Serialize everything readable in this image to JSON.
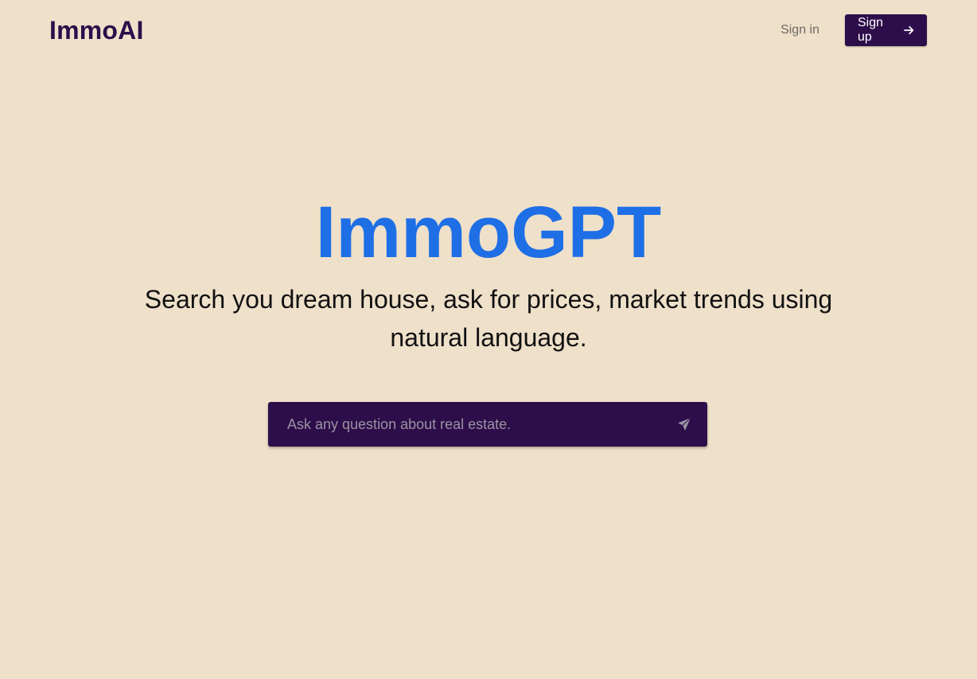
{
  "header": {
    "brand": "ImmoAI",
    "signin_label": "Sign in",
    "signup_label": "Sign up"
  },
  "hero": {
    "title": "ImmoGPT",
    "subtitle": "Search you dream house, ask for prices, market trends using natural language."
  },
  "search": {
    "placeholder": "Ask any question about real estate.",
    "value": "",
    "send_icon": "send-icon"
  },
  "colors": {
    "background": "#EFE0CA",
    "brand": "#2E0D4B",
    "accent": "#1E6FE6"
  }
}
